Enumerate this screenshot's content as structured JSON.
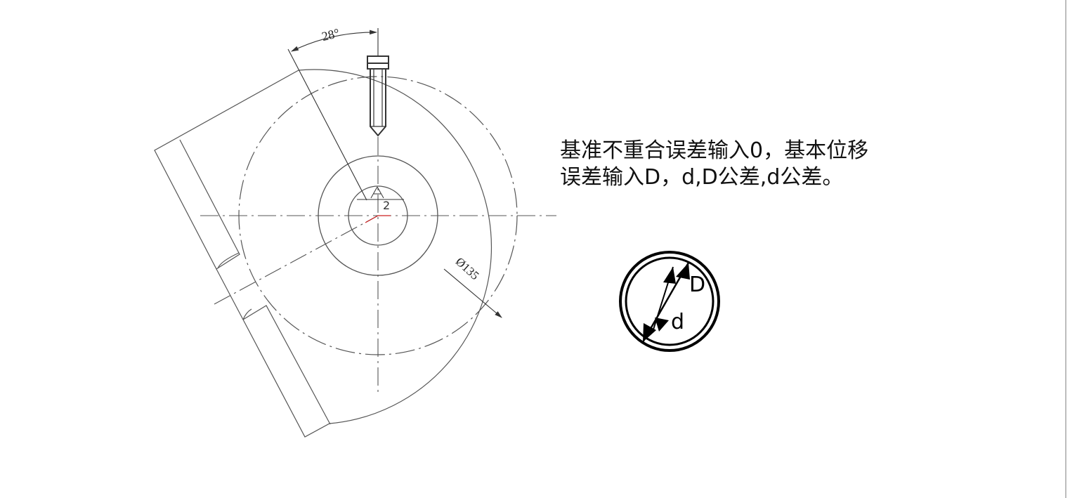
{
  "annotation": {
    "line1": "基准不重合误差输入0，基本位移",
    "line2": "误差输入D，d,D公差,d公差。"
  },
  "dimensions": {
    "angle": "28°",
    "offset": "2",
    "diameter": "Ø135"
  },
  "inset": {
    "outer_label": "D",
    "inner_label": "d"
  },
  "colors": {
    "line": "#444444",
    "center_mark": "#cc2222"
  }
}
